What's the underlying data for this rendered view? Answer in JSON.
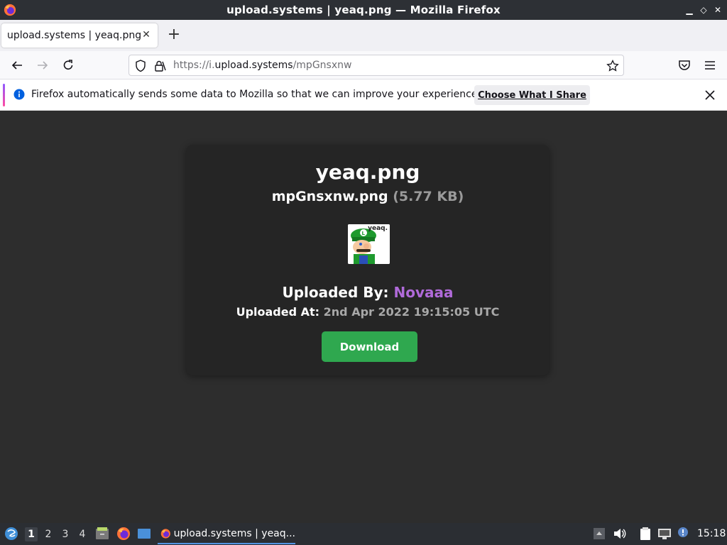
{
  "window": {
    "title": "upload.systems | yeaq.png — Mozilla Firefox"
  },
  "tabs": [
    {
      "label": "upload.systems | yeaq.png"
    }
  ],
  "urlbar": {
    "scheme": "https://i.",
    "host": "upload.systems",
    "path": "/mpGnsxnw"
  },
  "notification": {
    "message": "Firefox automatically sends some data to Mozilla so that we can improve your experience.",
    "button_label": "Choose What I Share"
  },
  "page": {
    "filename": "yeaq.png",
    "stored_name": "mpGnsxnw.png",
    "file_size": "(5.77 KB)",
    "thumbnail_watermark": "yeaq.",
    "uploaded_by_label": "Uploaded By:",
    "uploader": "Novaaa",
    "uploaded_at_label": "Uploaded At:",
    "uploaded_at": "2nd Apr 2022 19:15:05 UTC",
    "download_label": "Download"
  },
  "taskbar": {
    "workspaces": [
      "1",
      "2",
      "3",
      "4"
    ],
    "active_workspace": "1",
    "task_label": "upload.systems | yeaq...",
    "clock": "15:18"
  },
  "colors": {
    "background": "#2d2d2d",
    "card": "#252525",
    "uploader": "#b06ad9",
    "download": "#2fa84f"
  }
}
